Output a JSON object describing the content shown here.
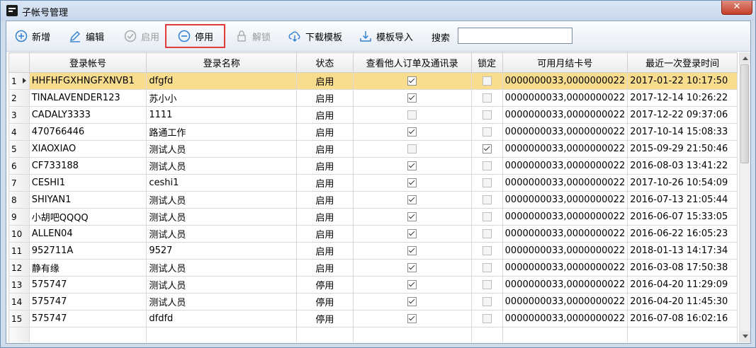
{
  "window": {
    "title": "子帐号管理",
    "close_label": "✕"
  },
  "toolbar": {
    "add_label": "新增",
    "edit_label": "编辑",
    "enable_label": "启用",
    "disable_label": "停用",
    "unlock_label": "解锁",
    "download_template_label": "下载模板",
    "import_template_label": "模板导入",
    "search_label": "搜索",
    "search_value": ""
  },
  "grid": {
    "columns": [
      "登录帐号",
      "登录名称",
      "状态",
      "查看他人订单及通讯录",
      "锁定",
      "可用月结卡号",
      "最近一次登录时间"
    ],
    "rows": [
      {
        "no": "1",
        "account": "HHFHFGXHNGFXNVB1",
        "name": "dfgfd",
        "status": "启用",
        "view_orders": true,
        "locked": false,
        "card": "0000000033,0000000022",
        "last_login": "2017-01-22 10:17:50"
      },
      {
        "no": "2",
        "account": "TINALAVENDER123",
        "name": "苏小小",
        "status": "启用",
        "view_orders": true,
        "locked": false,
        "card": "0000000033,0000000022",
        "last_login": "2017-12-14 10:26:22"
      },
      {
        "no": "3",
        "account": "CADALY3333",
        "name": "1111",
        "status": "启用",
        "view_orders": false,
        "locked": false,
        "card": "0000000033,0000000022",
        "last_login": "2017-12-22 09:37:06"
      },
      {
        "no": "4",
        "account": "470766446",
        "name": "路通工作",
        "status": "启用",
        "view_orders": true,
        "locked": false,
        "card": "0000000033,0000000022",
        "last_login": "2017-10-14 15:08:33"
      },
      {
        "no": "5",
        "account": "XIAOXIAO",
        "name": "测试人员",
        "status": "启用",
        "view_orders": false,
        "locked": true,
        "card": "0000000033,0000000022",
        "last_login": "2015-09-29 21:50:46"
      },
      {
        "no": "6",
        "account": "CF733188",
        "name": "测试人员",
        "status": "启用",
        "view_orders": true,
        "locked": false,
        "card": "0000000033,0000000022",
        "last_login": "2016-08-03 13:41:22"
      },
      {
        "no": "7",
        "account": "CESHI1",
        "name": "ceshi1",
        "status": "启用",
        "view_orders": true,
        "locked": false,
        "card": "0000000033,0000000022",
        "last_login": "2017-10-26 10:54:09"
      },
      {
        "no": "8",
        "account": "SHIYAN1",
        "name": "测试人员",
        "status": "启用",
        "view_orders": true,
        "locked": false,
        "card": "0000000033,0000000022",
        "last_login": "2016-07-13 21:05:44"
      },
      {
        "no": "9",
        "account": "小胡吧QQQQ",
        "name": "测试人员",
        "status": "启用",
        "view_orders": true,
        "locked": false,
        "card": "0000000033,0000000022",
        "last_login": "2016-06-07 15:33:05"
      },
      {
        "no": "10",
        "account": "ALLEN04",
        "name": "测试人员",
        "status": "启用",
        "view_orders": true,
        "locked": false,
        "card": "0000000033,0000000022",
        "last_login": "2016-06-22 16:05:23"
      },
      {
        "no": "11",
        "account": "952711A",
        "name": "9527",
        "status": "启用",
        "view_orders": true,
        "locked": false,
        "card": "0000000033,0000000022",
        "last_login": "2018-01-13 14:17:34"
      },
      {
        "no": "12",
        "account": "静有缘",
        "name": "测试人员",
        "status": "启用",
        "view_orders": true,
        "locked": false,
        "card": "0000000033,0000000022",
        "last_login": "2016-03-08 17:50:38"
      },
      {
        "no": "13",
        "account": "575747",
        "name": "测试人员",
        "status": "停用",
        "view_orders": true,
        "locked": false,
        "card": "0000000033,0000000022",
        "last_login": "2016-04-20 11:29:09"
      },
      {
        "no": "14",
        "account": "575747",
        "name": "测试人员",
        "status": "停用",
        "view_orders": true,
        "locked": false,
        "card": "0000000033,0000000022",
        "last_login": "2016-04-20 11:45:30"
      },
      {
        "no": "15",
        "account": "575747",
        "name": "dfdfd",
        "status": "停用",
        "view_orders": true,
        "locked": false,
        "card": "0000000033,0000000022",
        "last_login": "2016-07-08 16:02:16"
      }
    ]
  },
  "colors": {
    "selected_row": "#f8dd8e",
    "highlight": "#e23b3b",
    "icon_blue": "#2f7fd2"
  }
}
